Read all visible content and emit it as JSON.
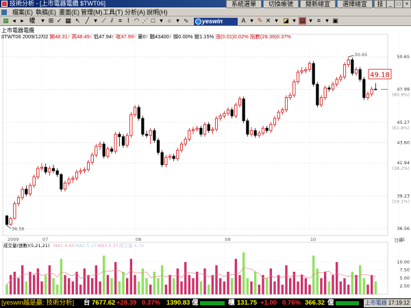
{
  "window": {
    "title": "技術分析 - [上市電器電纜 $TWT06]",
    "top_buttons": [
      "系統選單",
      "切換帳號",
      "閱新總宣",
      "選擇總宣",
      "技術分析"
    ]
  },
  "menu": {
    "items": [
      "檔案(E)",
      "執稿(E)",
      "畫面(E)",
      "管理(M)",
      "工具(T)",
      "分析(A)",
      "說明(H)"
    ]
  },
  "toolbar": {
    "brand": "yeswin",
    "period_label": "權"
  },
  "info": {
    "name": "上市電器電纜",
    "code_date": "$TWT06 2009/12/02",
    "open_label": "開",
    "open": "48.31",
    "high_label": "高",
    "high": "48.49",
    "low_label": "低",
    "low": "47.94",
    "close_label": "收",
    "close": "47.99",
    "vol_label": "量",
    "vol": "0",
    "amount_label": "額",
    "amount": "43400",
    "turnover_label": "換",
    "turnover": "0.00%",
    "amp_label": "振",
    "amp": "1.15%",
    "change_label": "漲",
    "change": "(0.01)",
    "change_pct": "0.02%",
    "index_label": "指數",
    "index": "(28.39)",
    "index_pct": "0.37%"
  },
  "chart_data": [
    {
      "type": "candlestick",
      "title": "上市電器電纜",
      "ylim": [
        36.0,
        52.5
      ],
      "yticks": [
        {
          "value": 50.65,
          "label": "50.65",
          "sub": ""
        },
        {
          "value": 47.99,
          "label": "47.99",
          "sub": "(80.9%)"
        },
        {
          "value": 45.27,
          "label": "45.27",
          "sub": "(61.8%)"
        },
        {
          "value": 43.6,
          "label": "43.60",
          "sub": ""
        },
        {
          "value": 41.94,
          "label": "41.94",
          "sub": "(38.2%)"
        },
        {
          "value": 39.23,
          "label": "39.23",
          "sub": "(19.1%)"
        },
        {
          "value": 36.56,
          "label": "36.56",
          "sub": ""
        }
      ],
      "xticks": [
        {
          "index": 0,
          "label": "2009"
        },
        {
          "index": 9,
          "label": "07"
        },
        {
          "index": 33,
          "label": "08"
        },
        {
          "index": 56,
          "label": "09"
        },
        {
          "index": 78,
          "label": "10"
        },
        {
          "index": 101,
          "label": "11"
        },
        {
          "index": 123,
          "label": "12"
        }
      ],
      "x_unit_label": "日線",
      "annotations": {
        "high_label": "50.65",
        "low_label": "36.56",
        "price_tag": "49.18",
        "last_price": "47.99"
      },
      "candles": [
        [
          37.6,
          36.9,
          37.7,
          36.8
        ],
        [
          36.9,
          37.4,
          37.5,
          36.8
        ],
        [
          37.4,
          38.6,
          38.8,
          37.3
        ],
        [
          38.6,
          39.1,
          39.3,
          38.4
        ],
        [
          39.1,
          39.8,
          40.0,
          38.9
        ],
        [
          39.8,
          39.4,
          40.1,
          39.2
        ],
        [
          39.4,
          40.1,
          40.3,
          39.2
        ],
        [
          40.1,
          40.8,
          41.0,
          39.9
        ],
        [
          40.8,
          41.5,
          41.7,
          40.6
        ],
        [
          41.5,
          41.6,
          41.9,
          41.3
        ],
        [
          41.6,
          41.2,
          41.9,
          41.0
        ],
        [
          41.2,
          41.5,
          41.7,
          40.9
        ],
        [
          41.5,
          41.3,
          41.8,
          41.1
        ],
        [
          41.3,
          41.0,
          41.5,
          40.8
        ],
        [
          41.0,
          39.8,
          41.1,
          39.6
        ],
        [
          39.8,
          40.3,
          40.5,
          39.6
        ],
        [
          40.3,
          40.6,
          40.8,
          40.1
        ],
        [
          40.6,
          40.7,
          40.9,
          40.3
        ],
        [
          40.7,
          41.2,
          41.4,
          40.5
        ],
        [
          41.2,
          41.3,
          41.5,
          41.0
        ],
        [
          41.3,
          41.4,
          41.6,
          41.1
        ],
        [
          41.4,
          42.0,
          42.2,
          41.2
        ],
        [
          42.0,
          42.6,
          42.8,
          41.8
        ],
        [
          42.6,
          43.3,
          43.5,
          42.4
        ],
        [
          43.3,
          43.5,
          43.7,
          43.0
        ],
        [
          43.5,
          42.5,
          43.7,
          42.3
        ],
        [
          42.5,
          43.1,
          43.3,
          42.3
        ],
        [
          43.1,
          42.9,
          43.3,
          42.7
        ],
        [
          42.9,
          44.3,
          44.5,
          42.7
        ],
        [
          44.3,
          44.1,
          44.5,
          43.3
        ],
        [
          44.1,
          43.4,
          44.3,
          43.2
        ],
        [
          43.4,
          44.2,
          44.4,
          43.2
        ],
        [
          44.2,
          45.9,
          46.1,
          44.0
        ],
        [
          45.9,
          46.5,
          46.7,
          45.7
        ],
        [
          46.5,
          45.6,
          46.7,
          45.4
        ],
        [
          45.6,
          44.3,
          45.8,
          44.1
        ],
        [
          44.3,
          44.2,
          44.6,
          44.0
        ],
        [
          44.2,
          44.6,
          44.8,
          43.5
        ],
        [
          44.6,
          43.8,
          44.8,
          43.6
        ],
        [
          43.8,
          42.8,
          44.0,
          42.6
        ],
        [
          42.8,
          41.8,
          43.0,
          41.6
        ],
        [
          41.8,
          42.4,
          42.6,
          41.6
        ],
        [
          42.4,
          42.5,
          42.7,
          42.2
        ],
        [
          42.5,
          42.3,
          42.7,
          42.1
        ],
        [
          42.3,
          43.0,
          43.2,
          42.1
        ],
        [
          43.0,
          43.5,
          43.7,
          42.8
        ],
        [
          43.5,
          43.9,
          44.1,
          43.3
        ],
        [
          43.9,
          44.6,
          44.8,
          43.7
        ],
        [
          44.6,
          44.7,
          44.9,
          44.3
        ],
        [
          44.7,
          44.8,
          45.0,
          44.5
        ],
        [
          44.8,
          44.3,
          45.0,
          44.1
        ],
        [
          44.3,
          45.1,
          45.3,
          44.1
        ],
        [
          45.1,
          44.6,
          45.3,
          44.4
        ],
        [
          44.6,
          44.7,
          44.9,
          44.3
        ],
        [
          44.7,
          45.6,
          45.8,
          44.5
        ],
        [
          45.6,
          45.8,
          46.0,
          45.4
        ],
        [
          45.8,
          46.0,
          46.2,
          45.6
        ],
        [
          46.0,
          46.3,
          46.5,
          45.8
        ],
        [
          46.3,
          45.8,
          46.5,
          45.6
        ],
        [
          45.8,
          46.7,
          46.9,
          45.6
        ],
        [
          46.7,
          47.2,
          47.4,
          46.5
        ],
        [
          47.2,
          45.4,
          47.4,
          45.2
        ],
        [
          45.4,
          44.3,
          45.6,
          44.1
        ],
        [
          44.3,
          44.6,
          44.9,
          44.1
        ],
        [
          44.6,
          44.2,
          44.8,
          44.0
        ],
        [
          44.2,
          44.4,
          44.6,
          44.0
        ],
        [
          44.4,
          44.8,
          45.0,
          44.2
        ],
        [
          44.8,
          44.6,
          45.0,
          44.4
        ],
        [
          44.6,
          45.1,
          45.3,
          44.4
        ],
        [
          45.1,
          45.6,
          45.8,
          44.9
        ],
        [
          45.6,
          46.1,
          46.3,
          45.4
        ],
        [
          46.1,
          46.3,
          46.5,
          45.9
        ],
        [
          46.3,
          47.3,
          47.5,
          46.1
        ],
        [
          47.3,
          47.5,
          47.7,
          47.1
        ],
        [
          47.5,
          48.6,
          48.8,
          47.3
        ],
        [
          48.6,
          49.4,
          49.6,
          48.4
        ],
        [
          49.4,
          49.5,
          49.8,
          49.2
        ],
        [
          49.5,
          49.6,
          49.8,
          49.3
        ],
        [
          49.6,
          50.1,
          50.3,
          49.4
        ],
        [
          50.1,
          48.4,
          50.3,
          48.2
        ],
        [
          48.4,
          46.7,
          48.6,
          46.5
        ],
        [
          46.7,
          47.3,
          47.5,
          46.5
        ],
        [
          47.3,
          48.1,
          48.3,
          47.1
        ],
        [
          48.1,
          48.0,
          48.3,
          47.8
        ],
        [
          48.0,
          48.4,
          48.6,
          47.8
        ],
        [
          48.4,
          48.8,
          49.0,
          48.2
        ],
        [
          48.8,
          49.0,
          49.2,
          48.6
        ],
        [
          49.0,
          50.0,
          50.2,
          48.8
        ],
        [
          50.0,
          50.4,
          50.65,
          49.8
        ],
        [
          50.4,
          49.3,
          50.6,
          49.1
        ],
        [
          49.3,
          49.6,
          49.8,
          49.1
        ],
        [
          49.6,
          48.8,
          49.8,
          48.6
        ],
        [
          48.8,
          47.3,
          49.0,
          47.1
        ],
        [
          47.3,
          47.6,
          47.8,
          47.1
        ],
        [
          47.6,
          48.0,
          48.2,
          47.4
        ],
        [
          48.0,
          47.99,
          48.49,
          47.94
        ]
      ]
    },
    {
      "type": "bar",
      "title": "成交量(張數)(5,21,21)",
      "legend": [
        {
          "name": "MA1",
          "value": "4.60",
          "color": "#e0a0b0"
        },
        {
          "name": "MA2",
          "value": "5.37",
          "color": "#a0d0e0"
        },
        {
          "name": "MA3",
          "value": "5.37",
          "color": "#e8a0c8"
        },
        {
          "name": "成交量",
          "value": "4.34",
          "color": "#c8c8e8"
        }
      ],
      "ylim": [
        0,
        14
      ],
      "yticks": [
        "10.00",
        "7.50",
        "5.00",
        "2.50"
      ],
      "values": [
        3,
        6,
        7,
        5,
        9,
        4,
        7,
        6,
        8,
        4,
        6,
        9,
        5,
        3,
        11,
        6,
        5,
        4,
        7,
        3,
        8,
        6,
        5,
        9,
        4,
        12,
        6,
        5,
        10,
        4,
        7,
        5,
        11,
        6,
        4,
        8,
        5,
        3,
        7,
        5,
        9,
        3,
        6,
        5,
        8,
        4,
        10,
        6,
        5,
        7,
        4,
        8,
        3,
        6,
        9,
        5,
        4,
        7,
        5,
        11,
        6,
        13,
        5,
        4,
        7,
        3,
        6,
        5,
        8,
        4,
        6,
        3,
        9,
        5,
        7,
        4,
        6,
        5,
        3,
        12,
        8,
        5,
        7,
        4,
        6,
        10,
        4,
        5,
        3,
        7,
        6,
        9,
        5,
        3,
        6,
        4
      ]
    }
  ],
  "status": {
    "brand": "[yeswin越是贏: 技術分析]",
    "idx1_label": "台",
    "idx1": "7677.62",
    "idx1_chg": "+28.39",
    "idx1_pct": "0.37%",
    "idx1_amt": "1390.83",
    "idx1_unit": "億",
    "idx2_label": "櫃",
    "idx2": "131.75",
    "idx2_chg": "+1.00",
    "idx2_pct": "0.76%",
    "idx2_amt": "366.32",
    "idx2_unit": "億",
    "tab": "上市電器",
    "time": "17:19:12"
  },
  "colors": {
    "up": "#d00000",
    "down": "#000000",
    "vol_up": "#d0306a",
    "vol_down": "#90e060"
  }
}
